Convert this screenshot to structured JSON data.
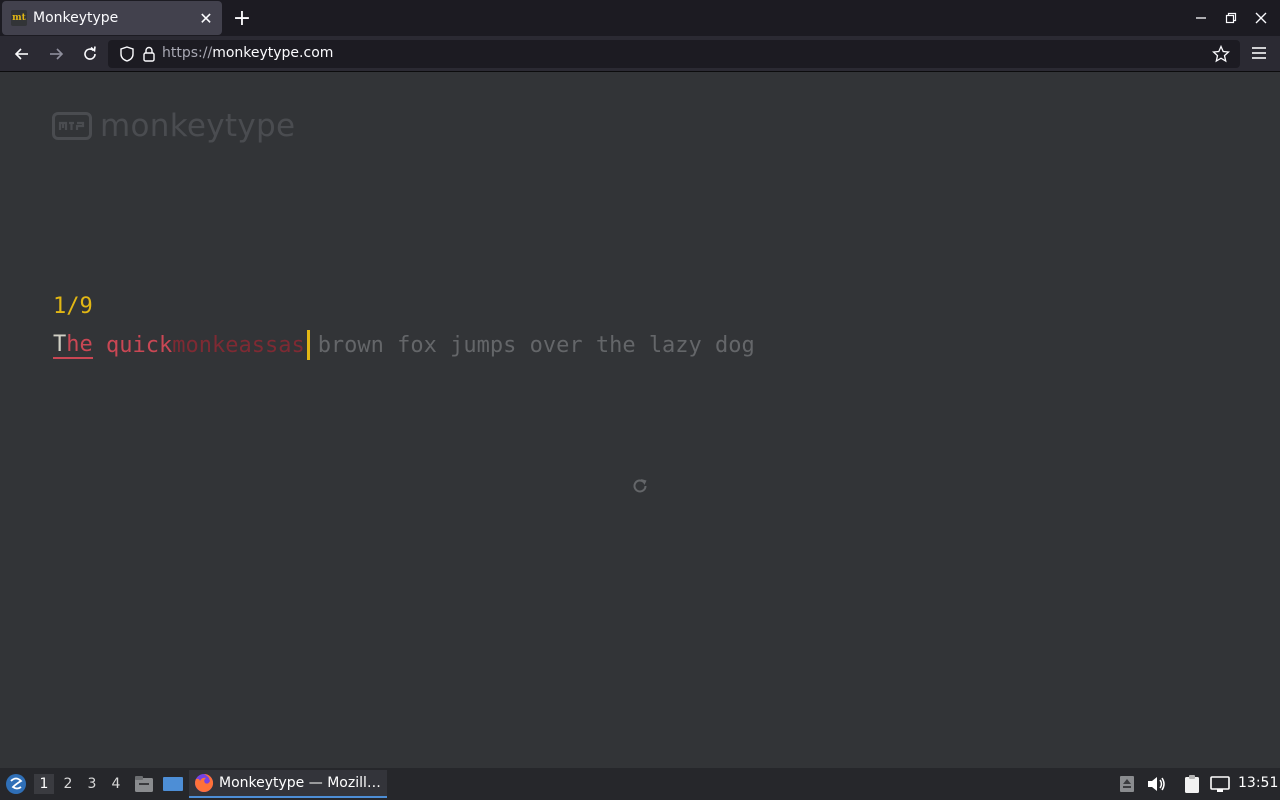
{
  "browser": {
    "tab_title": "Monkeytype",
    "tab_favicon": "mt",
    "url_scheme": "https://",
    "url_host": "monkeytype.com"
  },
  "page": {
    "logo_text": "monkeytype",
    "word_counter": "1/9",
    "typed": {
      "word1_first": "T",
      "word1_rest": "he",
      "space1": " ",
      "word2": "quick",
      "word2_extra": "monkeassas"
    },
    "pending_words": "brown fox jumps over the lazy dog"
  },
  "taskbar": {
    "workspaces": [
      "1",
      "2",
      "3",
      "4"
    ],
    "active_app": "Monkeytype — Mozill…",
    "clock": "13:51"
  },
  "colors": {
    "background": "#323437",
    "accent": "#e2b714",
    "error": "#ca4754",
    "error_extra": "#7e2a33",
    "pending": "#646669",
    "correct": "#d1d0c5"
  }
}
